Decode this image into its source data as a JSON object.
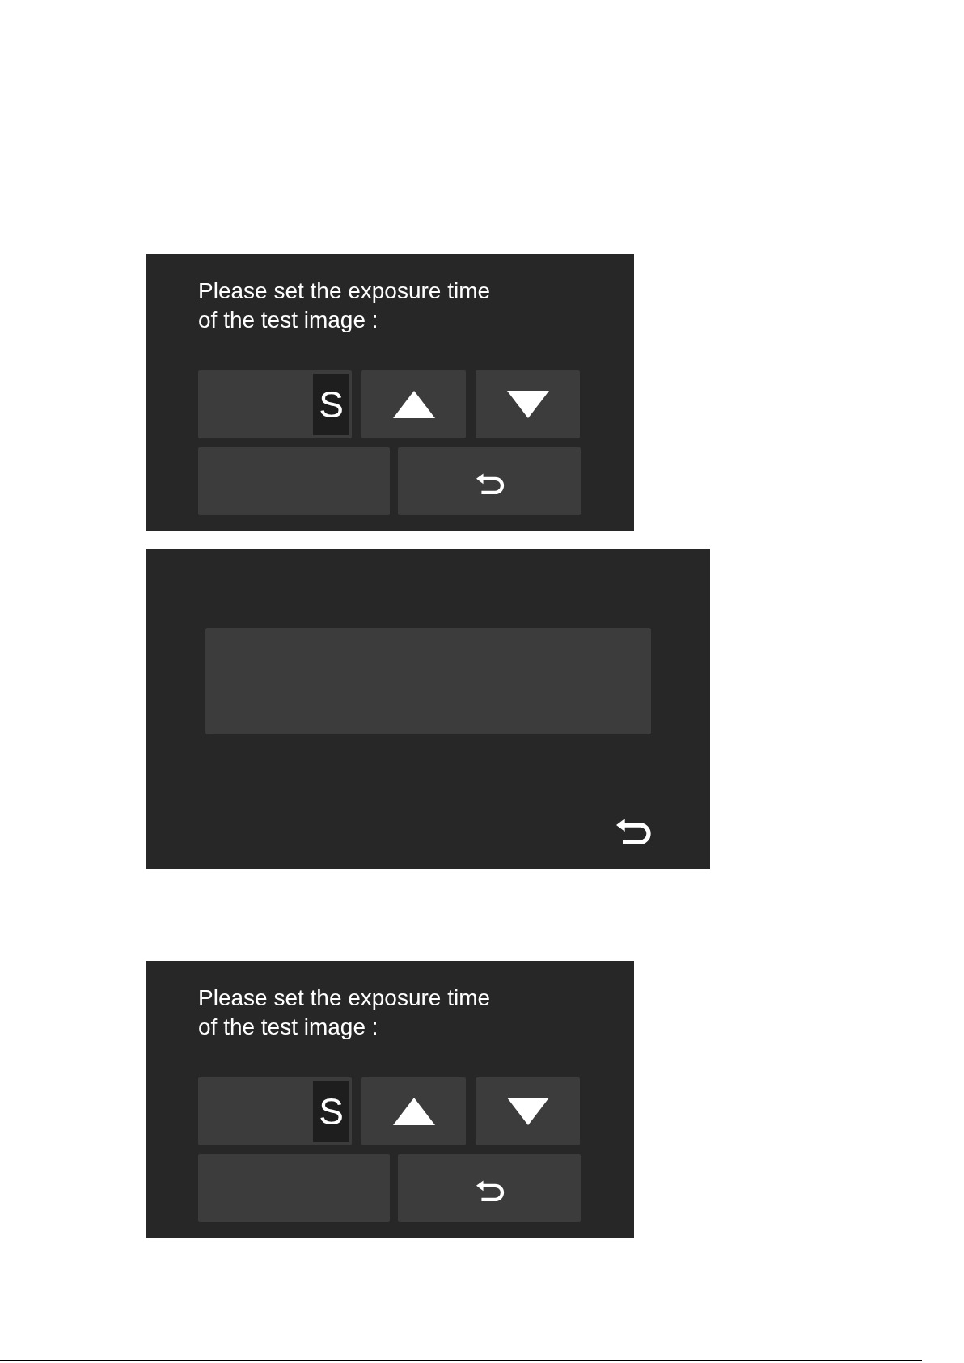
{
  "screens": [
    {
      "kind": "exposure",
      "prompt": "Please set the exposure time\nof the test image :",
      "unit": "S"
    },
    {
      "kind": "result"
    },
    {
      "kind": "exposure",
      "prompt": "Please set the exposure time\nof the test image :",
      "unit": "S"
    }
  ]
}
